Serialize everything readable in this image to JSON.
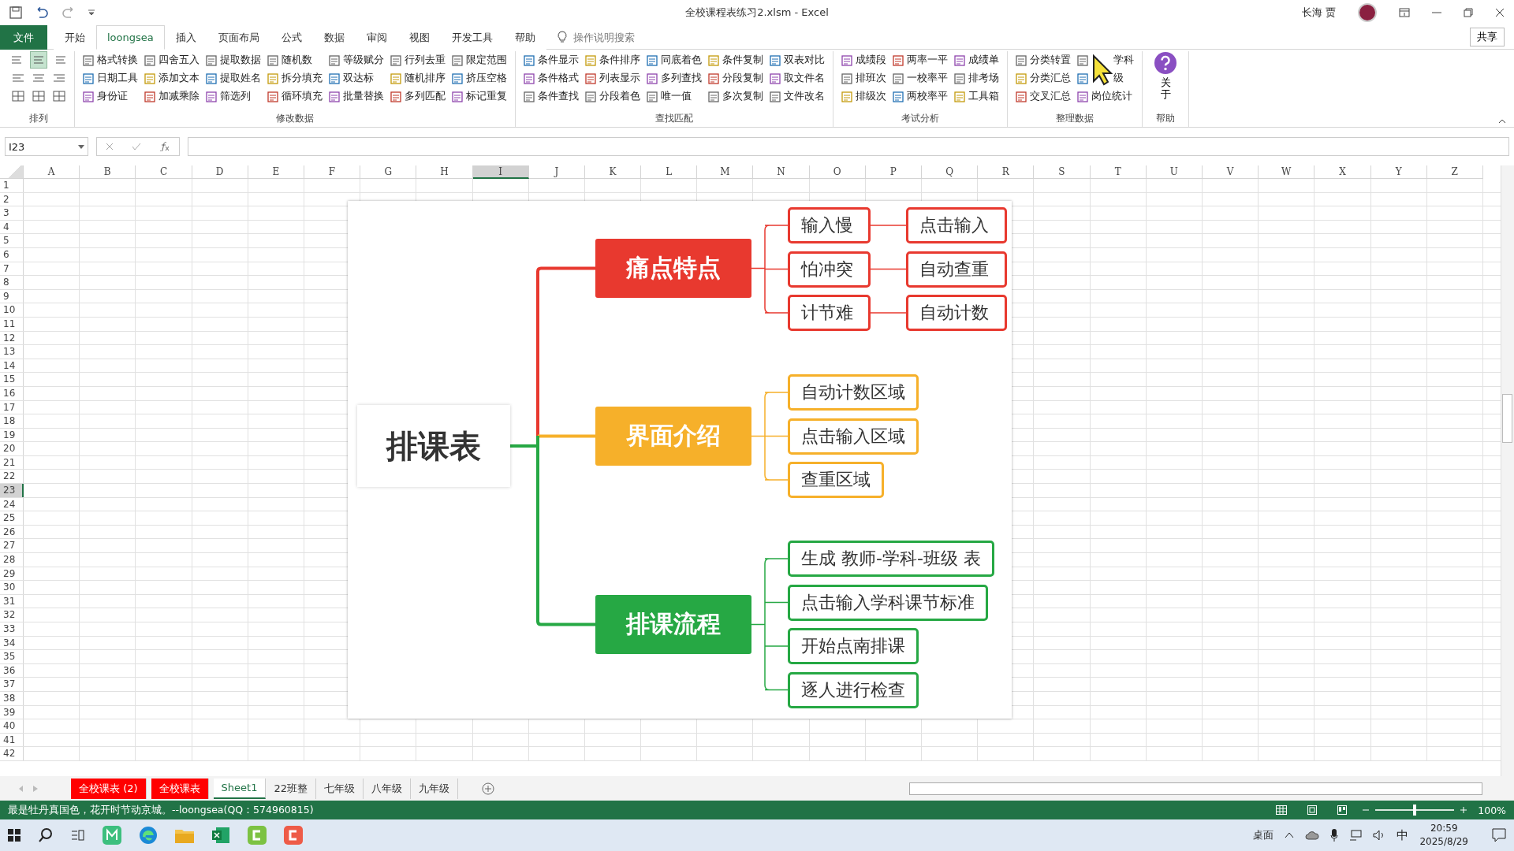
{
  "window": {
    "title": "全校课程表练习2.xlsm  -  Excel",
    "user": "长海 贾",
    "share": "共享"
  },
  "ribbon_tabs": [
    {
      "label": "文件",
      "kind": "file",
      "selected": false
    },
    {
      "label": "开始",
      "kind": "tab",
      "selected": false
    },
    {
      "label": "loongsea",
      "kind": "tab",
      "selected": true
    },
    {
      "label": "插入",
      "kind": "tab",
      "selected": false
    },
    {
      "label": "页面布局",
      "kind": "tab",
      "selected": false
    },
    {
      "label": "公式",
      "kind": "tab",
      "selected": false
    },
    {
      "label": "数据",
      "kind": "tab",
      "selected": false
    },
    {
      "label": "审阅",
      "kind": "tab",
      "selected": false
    },
    {
      "label": "视图",
      "kind": "tab",
      "selected": false
    },
    {
      "label": "开发工具",
      "kind": "tab",
      "selected": false
    },
    {
      "label": "帮助",
      "kind": "tab",
      "selected": false
    }
  ],
  "tell_me": {
    "placeholder": "操作说明搜索"
  },
  "ribbon_groups": [
    {
      "title": "排列",
      "kind": "align",
      "buttons": [
        {
          "selected": false
        },
        {
          "selected": false
        },
        {
          "selected": false
        },
        {
          "selected": true
        },
        {
          "selected": false
        },
        {
          "selected": false
        },
        {
          "selected": false
        },
        {
          "selected": false
        },
        {
          "selected": false
        }
      ]
    },
    {
      "title": "修改数据",
      "kind": "list",
      "items": [
        "格式转换",
        "日期工具",
        "身份证",
        "四舍五入",
        "添加文本",
        "加减乘除",
        "提取数据",
        "提取姓名",
        "筛选列",
        "随机数",
        "拆分填充",
        "循环填充",
        "等级赋分",
        "双达标",
        "批量替换",
        "行列去重",
        "随机排序",
        "多列匹配",
        "限定范围",
        "挤压空格",
        "标记重复"
      ]
    },
    {
      "title": "查找匹配",
      "kind": "list",
      "items": [
        "条件显示",
        "条件格式",
        "条件查找",
        "条件排序",
        "列表显示",
        "分段着色",
        "同底着色",
        "多列查找",
        "唯一值",
        "条件复制",
        "分段复制",
        "多次复制",
        "双表对比",
        "取文件名",
        "文件改名"
      ]
    },
    {
      "title": "考试分析",
      "kind": "list",
      "items": [
        "成绩段",
        "排班次",
        "排级次",
        "两率一平",
        "一校率平",
        "两校率平",
        "成绩单",
        "排考场",
        "工具箱"
      ]
    },
    {
      "title": "整理数据",
      "kind": "list",
      "cursor": true,
      "items": [
        "分类转置",
        "分类汇总",
        "交叉汇总",
        "学科",
        "级",
        "岗位统计"
      ]
    },
    {
      "title": "帮助",
      "kind": "big",
      "items": [
        "关于"
      ]
    }
  ],
  "formula_bar": {
    "name_box": "I23"
  },
  "columns": [
    {
      "label": "A",
      "selected": false
    },
    {
      "label": "B",
      "selected": false
    },
    {
      "label": "C",
      "selected": false
    },
    {
      "label": "D",
      "selected": false
    },
    {
      "label": "E",
      "selected": false
    },
    {
      "label": "F",
      "selected": false
    },
    {
      "label": "G",
      "selected": false
    },
    {
      "label": "H",
      "selected": false
    },
    {
      "label": "I",
      "selected": true
    },
    {
      "label": "J",
      "selected": false
    },
    {
      "label": "K",
      "selected": false
    },
    {
      "label": "L",
      "selected": false
    },
    {
      "label": "M",
      "selected": false
    },
    {
      "label": "N",
      "selected": false
    },
    {
      "label": "O",
      "selected": false
    },
    {
      "label": "P",
      "selected": false
    },
    {
      "label": "Q",
      "selected": false
    },
    {
      "label": "R",
      "selected": false
    },
    {
      "label": "S",
      "selected": false
    },
    {
      "label": "T",
      "selected": false
    },
    {
      "label": "U",
      "selected": false
    },
    {
      "label": "V",
      "selected": false
    },
    {
      "label": "W",
      "selected": false
    },
    {
      "label": "X",
      "selected": false
    },
    {
      "label": "Y",
      "selected": false
    },
    {
      "label": "Z",
      "selected": false
    }
  ],
  "rows": [
    {
      "label": "1",
      "selected": false
    },
    {
      "label": "2",
      "selected": false
    },
    {
      "label": "3",
      "selected": false
    },
    {
      "label": "4",
      "selected": false
    },
    {
      "label": "5",
      "selected": false
    },
    {
      "label": "6",
      "selected": false
    },
    {
      "label": "7",
      "selected": false
    },
    {
      "label": "8",
      "selected": false
    },
    {
      "label": "9",
      "selected": false
    },
    {
      "label": "10",
      "selected": false
    },
    {
      "label": "11",
      "selected": false
    },
    {
      "label": "12",
      "selected": false
    },
    {
      "label": "13",
      "selected": false
    },
    {
      "label": "14",
      "selected": false
    },
    {
      "label": "15",
      "selected": false
    },
    {
      "label": "16",
      "selected": false
    },
    {
      "label": "17",
      "selected": false
    },
    {
      "label": "18",
      "selected": false
    },
    {
      "label": "19",
      "selected": false
    },
    {
      "label": "20",
      "selected": false
    },
    {
      "label": "21",
      "selected": false
    },
    {
      "label": "22",
      "selected": false
    },
    {
      "label": "23",
      "selected": true
    },
    {
      "label": "24",
      "selected": false
    },
    {
      "label": "25",
      "selected": false
    },
    {
      "label": "26",
      "selected": false
    },
    {
      "label": "27",
      "selected": false
    },
    {
      "label": "28",
      "selected": false
    },
    {
      "label": "29",
      "selected": false
    },
    {
      "label": "30",
      "selected": false
    },
    {
      "label": "31",
      "selected": false
    },
    {
      "label": "32",
      "selected": false
    },
    {
      "label": "33",
      "selected": false
    },
    {
      "label": "34",
      "selected": false
    },
    {
      "label": "35",
      "selected": false
    },
    {
      "label": "36",
      "selected": false
    },
    {
      "label": "37",
      "selected": false
    },
    {
      "label": "38",
      "selected": false
    },
    {
      "label": "39",
      "selected": false
    },
    {
      "label": "40",
      "selected": false
    },
    {
      "label": "41",
      "selected": false
    },
    {
      "label": "42",
      "selected": false
    }
  ],
  "mind_map": {
    "root": "排课表",
    "branches": [
      {
        "label": "痛点特点",
        "color": "#e8392f",
        "leaves": [
          {
            "label": "输入慢",
            "next": "点击输入"
          },
          {
            "label": "怕冲突",
            "next": "自动查重"
          },
          {
            "label": "计节难",
            "next": "自动计数"
          }
        ]
      },
      {
        "label": "界面介绍",
        "color": "#f6b02a",
        "leaves": [
          {
            "label": "自动计数区域"
          },
          {
            "label": "点击输入区域"
          },
          {
            "label": "查重区域"
          }
        ]
      },
      {
        "label": "排课流程",
        "color": "#26a844",
        "leaves": [
          {
            "label": "生成 教师-学科-班级 表"
          },
          {
            "label": "点击输入学科课节标准"
          },
          {
            "label": "开始点南排课"
          },
          {
            "label": "逐人进行检查"
          }
        ]
      }
    ]
  },
  "sheet_tabs": [
    {
      "label": "全校课表 (2)",
      "color": "#ff0000",
      "selected": false
    },
    {
      "label": "全校课表",
      "color": "#ff0000",
      "selected": false
    },
    {
      "label": "Sheet1",
      "selected": true
    },
    {
      "label": "22班整",
      "selected": false
    },
    {
      "label": "七年级",
      "selected": false
    },
    {
      "label": "八年级",
      "selected": false
    },
    {
      "label": "九年级",
      "selected": false
    }
  ],
  "status_bar": {
    "message": "最是牡丹真国色，花开时节动京城。--loongsea(QQ：574960815)",
    "zoom": "100%",
    "zoom_slider": {
      "level": 0.5
    }
  },
  "taskbar": {
    "desktop": "桌面",
    "ime": "中",
    "time": "20:59",
    "date": "2025/8/29"
  }
}
